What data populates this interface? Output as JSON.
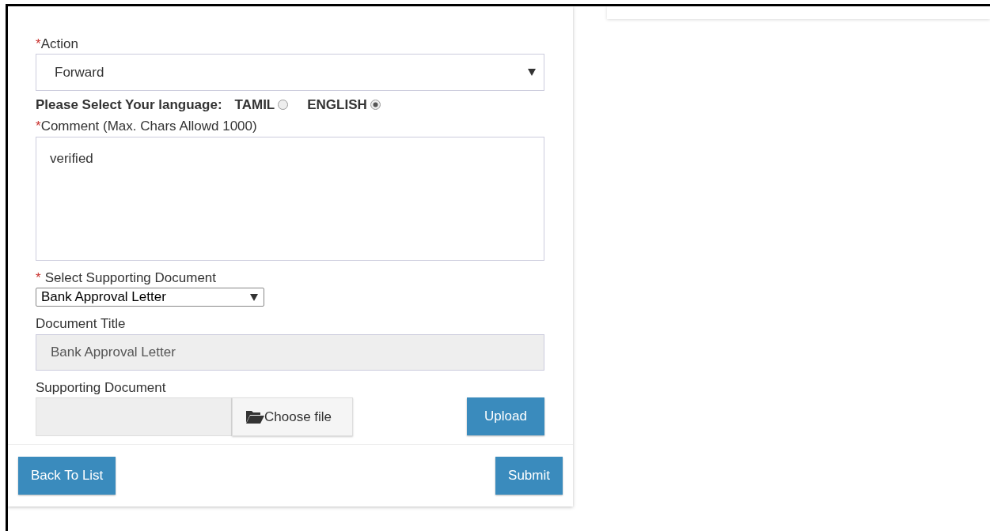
{
  "action": {
    "required_mark": "*",
    "label": "Action",
    "value": "Forward"
  },
  "language": {
    "label": "Please Select Your language:",
    "options": [
      {
        "label": "TAMIL",
        "selected": false
      },
      {
        "label": "ENGLISH",
        "selected": true
      }
    ]
  },
  "comment": {
    "required_mark": "*",
    "label": "Comment (Max. Chars Allowd 1000)",
    "value": "verified"
  },
  "supporting_document_type": {
    "required_mark": "*",
    "label": "Select Supporting Document",
    "value": "Bank Approval Letter"
  },
  "document_title": {
    "label": "Document Title",
    "value": "Bank Approval Letter",
    "disabled": true
  },
  "supporting_document": {
    "label": "Supporting Document",
    "choose_label": "Choose file",
    "upload_label": "Upload"
  },
  "footer_buttons": [
    "Back To List",
    "Submit"
  ]
}
